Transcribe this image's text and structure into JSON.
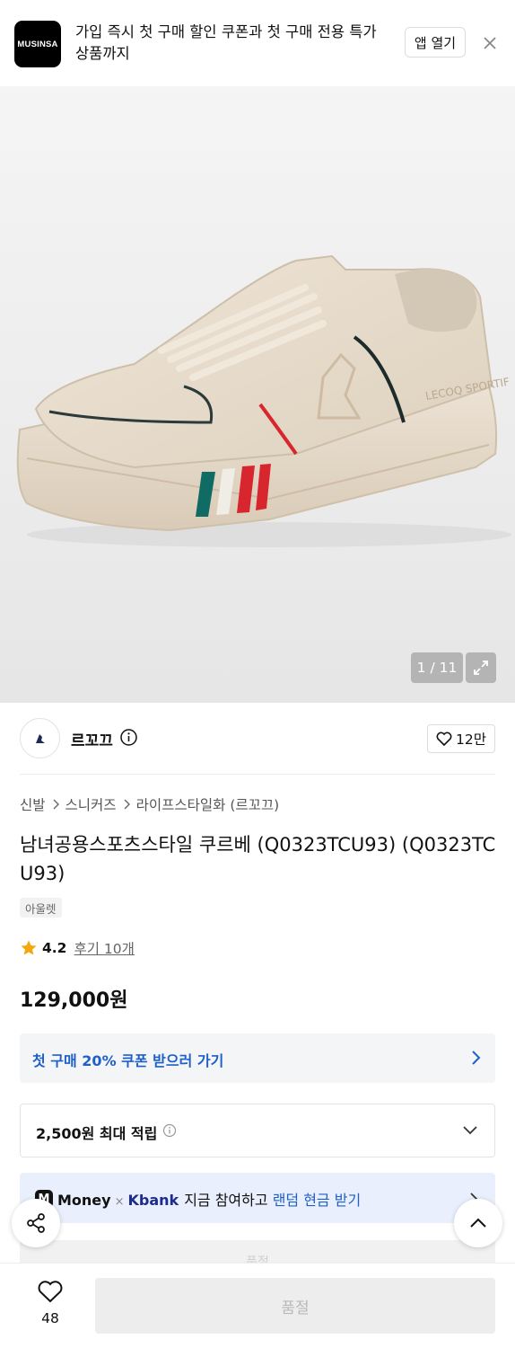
{
  "banner": {
    "logo_text": "MUSINSA",
    "text_line1": "가입 즉시 첫 구매 할인 쿠폰과 첫 구매 전용 특가",
    "text_line2": "상품까지",
    "app_open_label": "앱 열기"
  },
  "gallery": {
    "counter": "1 / 11"
  },
  "brand": {
    "name": "르꼬끄",
    "likes": "12만"
  },
  "breadcrumb": [
    "신발",
    "스니커즈",
    "라이프스타일화 (르꼬끄)"
  ],
  "product": {
    "title": "남녀공용스포츠스타일 쿠르베 (Q0323TCU93) (Q0323TCU93)",
    "tag": "아울렛",
    "rating": "4.2",
    "reviews": "후기 10개",
    "price": "129,000원"
  },
  "coupon": {
    "label": "첫 구매 20% 쿠폰 받으러 가기"
  },
  "points": {
    "label": "2,500원 최대 적립"
  },
  "promo": {
    "m": "M",
    "money": "Money",
    "x": "×",
    "kbank": "Kbank",
    "text": "지금 참여하고",
    "highlight": "랜덤 현금 받기"
  },
  "ghost": {
    "label": "품절"
  },
  "bottom": {
    "wish_count": "48",
    "soldout_label": "품절"
  },
  "colors": {
    "accent_blue": "#1e5fc9",
    "shoe_body": "#e7dac8",
    "stripe_red": "#d8262e",
    "stripe_green": "#0f6b63"
  }
}
